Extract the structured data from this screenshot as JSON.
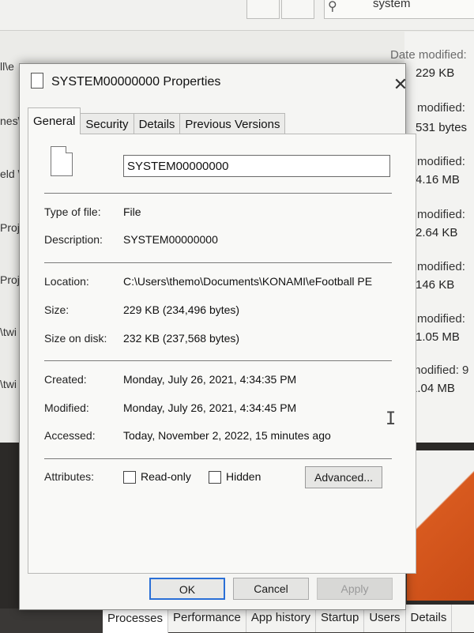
{
  "background": {
    "search_text": "system",
    "column_header": "Date modified:",
    "left_fragments": [
      "ll\\e",
      "nes\\",
      "eld \\",
      "Proj",
      "Proj",
      "\\twi",
      "\\twi"
    ],
    "rows": [
      {
        "date": "",
        "size": "229 KB"
      },
      {
        "date": "modified:",
        "size": "531 bytes"
      },
      {
        "date": "modified:",
        "size": "4.16 MB"
      },
      {
        "date": "modified:",
        "size": "2.64 KB"
      },
      {
        "date": "modified:",
        "size": "146 KB"
      },
      {
        "date": "modified:",
        "size": "1.05 MB"
      },
      {
        "date": "modified: 9",
        "size": "1.04 MB"
      }
    ]
  },
  "taskmanager": {
    "tabs": [
      "Processes",
      "Performance",
      "App history",
      "Startup",
      "Users",
      "Details"
    ]
  },
  "dialog": {
    "title": "SYSTEM00000000 Properties",
    "close": "✕",
    "tabs": [
      "General",
      "Security",
      "Details",
      "Previous Versions"
    ],
    "file_name": "SYSTEM00000000",
    "fields": {
      "type": {
        "label": "Type of file:",
        "value": "File"
      },
      "description": {
        "label": "Description:",
        "value": "SYSTEM00000000"
      },
      "location": {
        "label": "Location:",
        "value": "C:\\Users\\themo\\Documents\\KONAMI\\eFootball PE"
      },
      "size": {
        "label": "Size:",
        "value": "229 KB (234,496 bytes)"
      },
      "size_on_disk": {
        "label": "Size on disk:",
        "value": "232 KB (237,568 bytes)"
      },
      "created": {
        "label": "Created:",
        "value": "Monday, July 26, 2021, 4:34:35 PM"
      },
      "modified": {
        "label": "Modified:",
        "value": "Monday, July 26, 2021, 4:34:45 PM"
      },
      "accessed": {
        "label": "Accessed:",
        "value": "Today, November 2, 2022, 15 minutes ago"
      }
    },
    "attributes": {
      "label": "Attributes:",
      "readonly": "Read-only",
      "hidden": "Hidden",
      "advanced": "Advanced..."
    },
    "buttons": {
      "ok": "OK",
      "cancel": "Cancel",
      "apply": "Apply"
    },
    "cursor_glyph": "I"
  }
}
